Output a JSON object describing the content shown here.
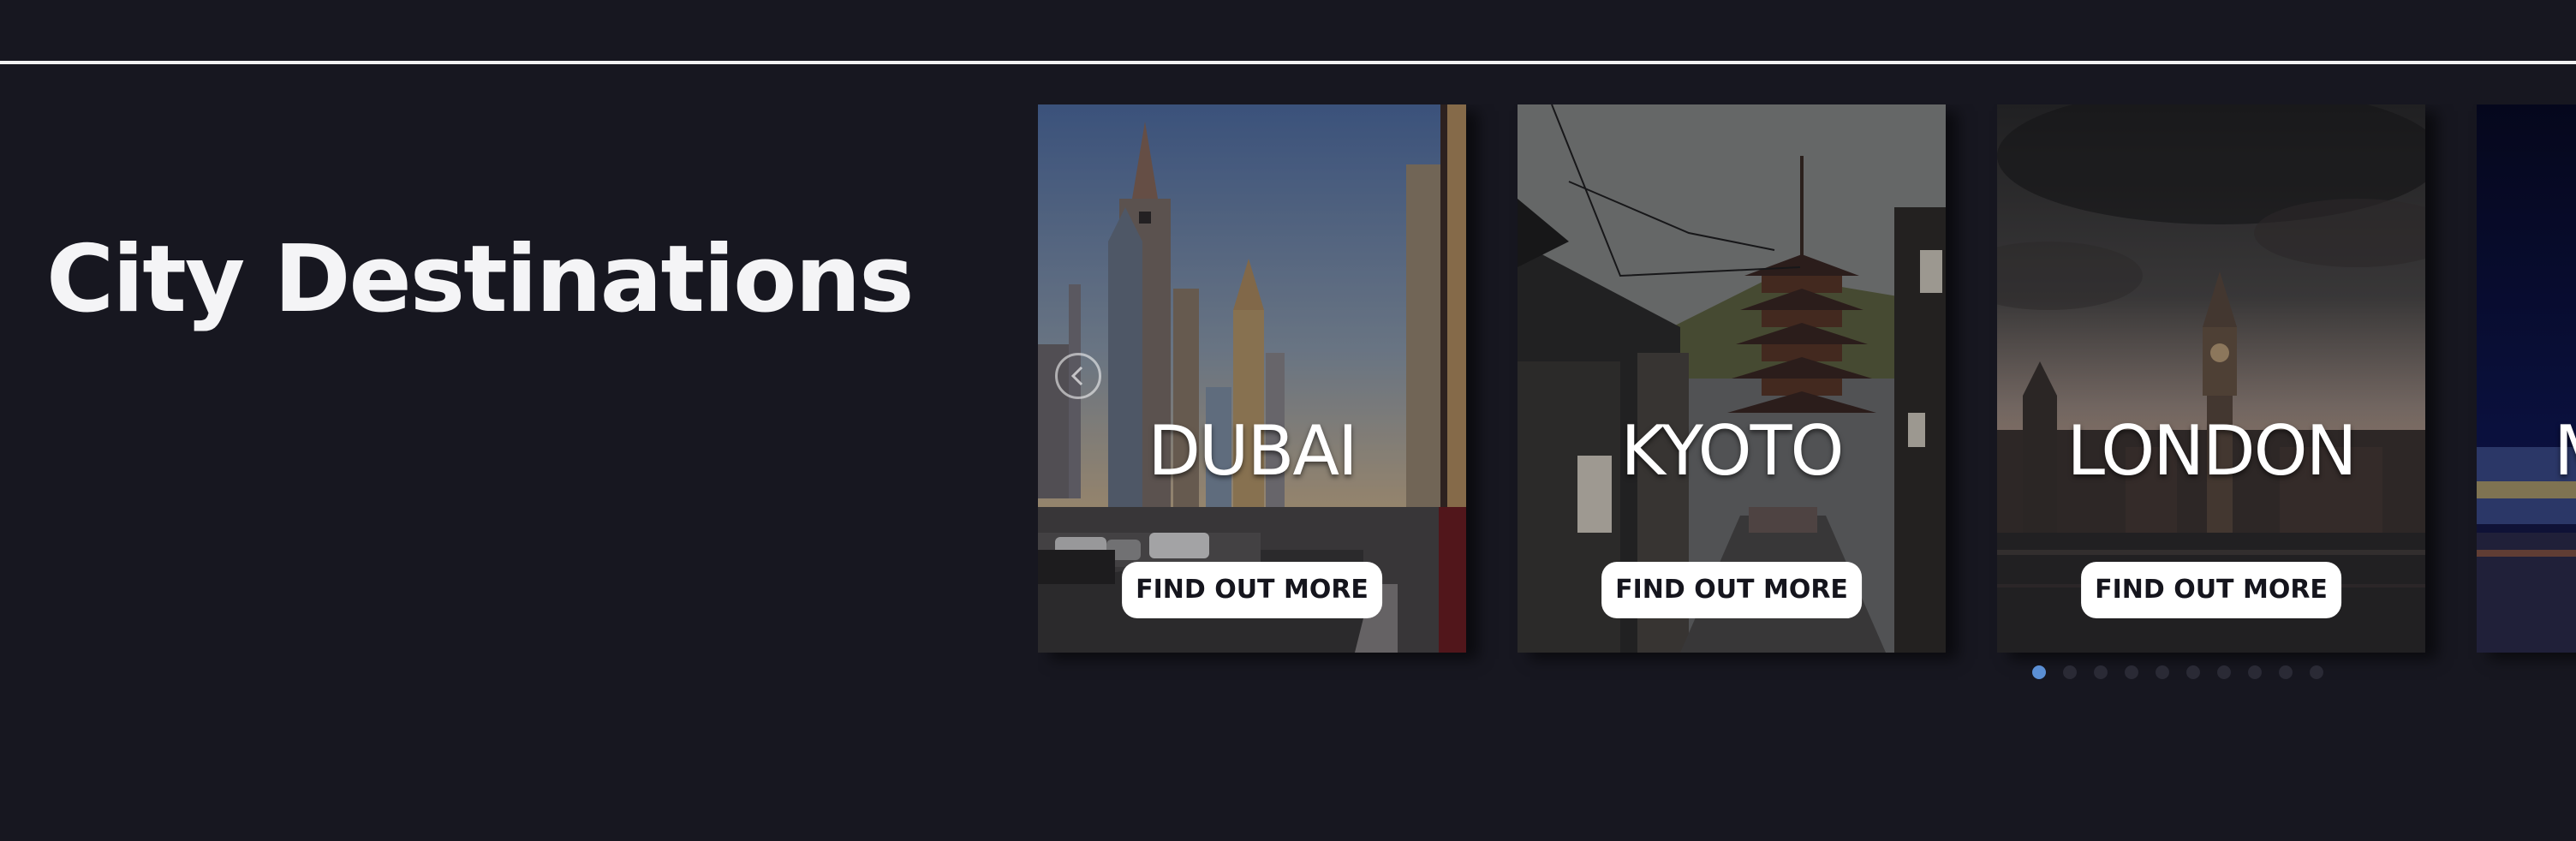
{
  "page": {
    "title": "City Destinations"
  },
  "carousel": {
    "cards": [
      {
        "city": "DUBAI",
        "button_label": "FIND OUT MORE"
      },
      {
        "city": "KYOTO",
        "button_label": "FIND OUT MORE"
      },
      {
        "city": "LONDON",
        "button_label": "FIND OUT MORE"
      },
      {
        "city": "M",
        "button_label": ""
      }
    ],
    "active_dot": 0,
    "dot_count": 10
  },
  "icons": {
    "prev": "chevron-left-icon"
  },
  "colors": {
    "background": "#171720",
    "rule": "#f2f2f2",
    "dot_active": "#5b8fd4",
    "dot_inactive": "#2a2a35",
    "button_bg": "#ffffff",
    "button_text": "#15151d"
  }
}
